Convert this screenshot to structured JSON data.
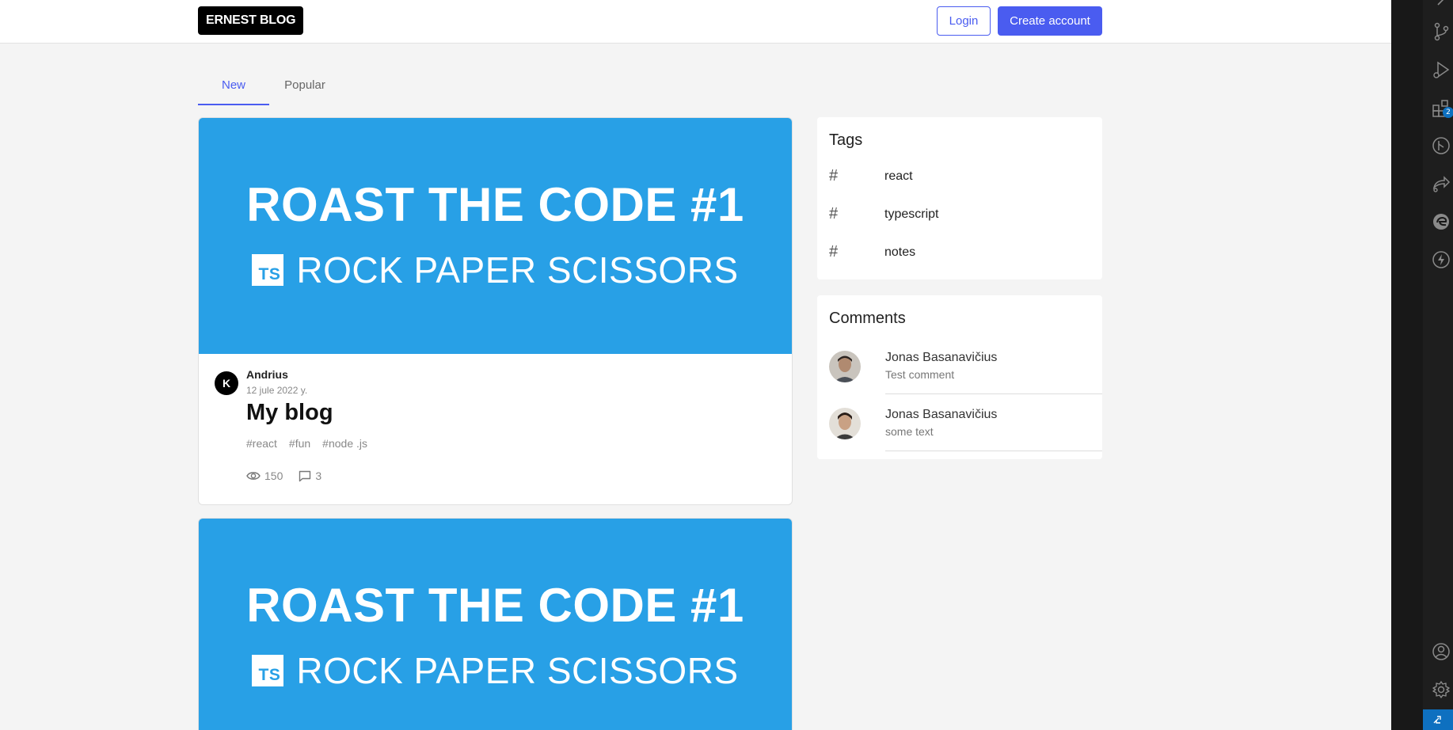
{
  "header": {
    "logo": "ERNEST BLOG",
    "login_label": "Login",
    "create_account_label": "Create account"
  },
  "tabs": [
    {
      "label": "New",
      "active": true
    },
    {
      "label": "Popular",
      "active": false
    }
  ],
  "posts": [
    {
      "cover_title": "ROAST THE CODE #1",
      "cover_subtitle": "ROCK PAPER SCISSORS",
      "cover_badge": "TS",
      "author_initial": "K",
      "author": "Andrius",
      "date": "12 jule 2022 y.",
      "title": "My blog",
      "tags": [
        "#react",
        "#fun",
        "#node .js"
      ],
      "views": "150",
      "comments": "3"
    },
    {
      "cover_title": "ROAST THE CODE #1",
      "cover_subtitle": "ROCK PAPER SCISSORS",
      "cover_badge": "TS"
    }
  ],
  "sidebar": {
    "tags_title": "Tags",
    "tags": [
      "react",
      "typescript",
      "notes"
    ],
    "comments_title": "Comments",
    "comments": [
      {
        "name": "Jonas Basanavičius",
        "text": "Test comment"
      },
      {
        "name": "Jonas Basanavičius",
        "text": "some text"
      }
    ]
  },
  "activity_bar": {
    "icons": [
      "source-control-icon",
      "run-debug-icon",
      "extensions-icon",
      "git-graph-icon",
      "remote-share-icon",
      "edge-devtools-icon",
      "lightning-icon",
      "account-icon",
      "settings-gear-icon",
      "remote-indicator-icon"
    ],
    "extensions_badge": "2"
  },
  "colors": {
    "accent": "#4a5cf0",
    "cover_blue": "#28a0e6"
  }
}
